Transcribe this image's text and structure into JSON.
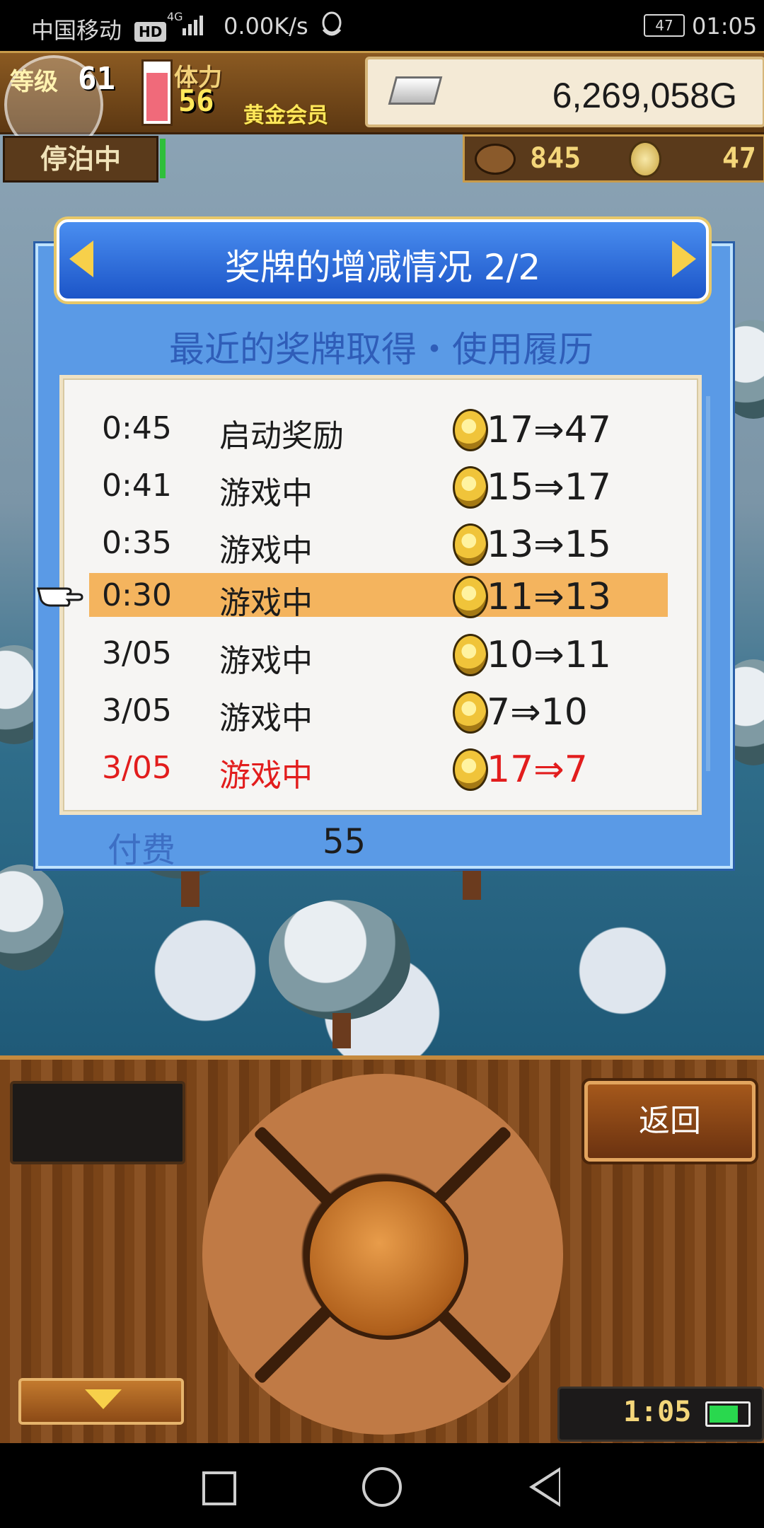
{
  "status_bar": {
    "carrier": "中国移动",
    "hd": "HD",
    "network": "4G",
    "speed": "0.00K/s",
    "battery": "47",
    "time": "01:05"
  },
  "hud": {
    "level_label": "等级",
    "level": "61",
    "stamina_label": "体力",
    "stamina": "56",
    "stamina_fill_fraction": 0.85,
    "vip": "黄金会员",
    "gold": "6,269,058G",
    "docked": "停泊中",
    "fish_count": "845",
    "medal_count": "47"
  },
  "dialog": {
    "title": "奖牌的增减情况 2/2",
    "subtitle": "最近的奖牌取得・使用履历",
    "fee_label": "付费",
    "fee_value": "55",
    "rows": [
      {
        "time": "0:45",
        "desc": "启动奖励",
        "change": "17⇒47",
        "state": "normal"
      },
      {
        "time": "0:41",
        "desc": "游戏中",
        "change": "15⇒17",
        "state": "normal"
      },
      {
        "time": "0:35",
        "desc": "游戏中",
        "change": "13⇒15",
        "state": "normal"
      },
      {
        "time": "0:30",
        "desc": "游戏中",
        "change": "11⇒13",
        "state": "selected"
      },
      {
        "time": "3/05",
        "desc": "游戏中",
        "change": "10⇒11",
        "state": "normal"
      },
      {
        "time": "3/05",
        "desc": "游戏中",
        "change": "7⇒10",
        "state": "normal"
      },
      {
        "time": "3/05",
        "desc": "游戏中",
        "change": "17⇒7",
        "state": "red"
      }
    ]
  },
  "controls": {
    "back_label": "返回",
    "clock": "1:05"
  },
  "colors": {
    "highlight": "#f4b45e",
    "negative": "#e21d1d",
    "dialog_blue": "#5a9ae6"
  }
}
